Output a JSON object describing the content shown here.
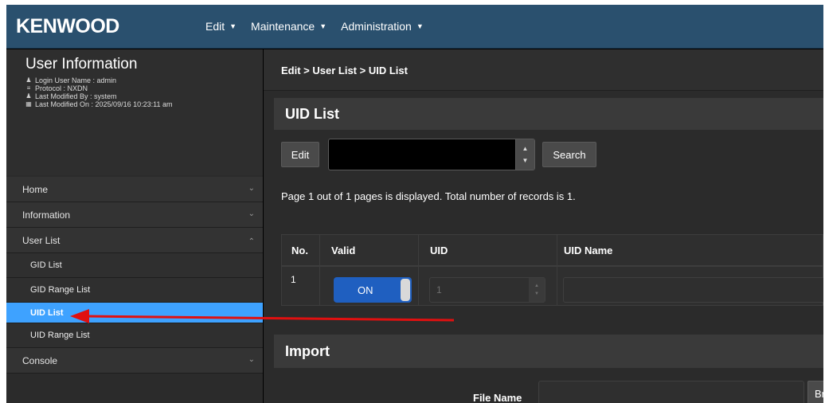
{
  "brand": "KENWOOD",
  "nav": [
    {
      "label": "Edit"
    },
    {
      "label": "Maintenance"
    },
    {
      "label": "Administration"
    }
  ],
  "user_info": {
    "title": "User Information",
    "lines": [
      {
        "icon": "user-icon",
        "text": "Login User Name : admin"
      },
      {
        "icon": "list-icon",
        "text": "Protocol : NXDN"
      },
      {
        "icon": "user-icon",
        "text": "Last Modified By : system"
      },
      {
        "icon": "calendar-icon",
        "text": "Last Modified On : 2025/09/16 10:23:11 am"
      }
    ]
  },
  "sidebar": {
    "items": [
      {
        "label": "Home",
        "state": "collapsed"
      },
      {
        "label": "Information",
        "state": "collapsed"
      },
      {
        "label": "User List",
        "state": "expanded"
      },
      {
        "label": "Console",
        "state": "collapsed"
      }
    ],
    "user_list_children": [
      {
        "label": "GID List"
      },
      {
        "label": "GID Range List"
      },
      {
        "label": "UID List",
        "active": true
      },
      {
        "label": "UID Range List"
      }
    ]
  },
  "breadcrumb": "Edit  > User List > UID List",
  "uid_list": {
    "title": "UID List",
    "edit_label": "Edit",
    "search_label": "Search",
    "page_info": "Page 1 out of 1 pages is displayed. Total number of records is 1.",
    "columns": [
      "No.",
      "Valid",
      "UID",
      "UID Name"
    ],
    "rows": [
      {
        "no": "1",
        "valid": "ON",
        "uid": "1",
        "uid_name": ""
      }
    ]
  },
  "import": {
    "title": "Import",
    "file_name_label": "File Name",
    "browse_label": "Br"
  },
  "colors": {
    "navbar": "#2a506e",
    "active_menu": "#3ea2ff",
    "toggle_on": "#1f5fc0",
    "annotation_arrow": "#e01010"
  }
}
